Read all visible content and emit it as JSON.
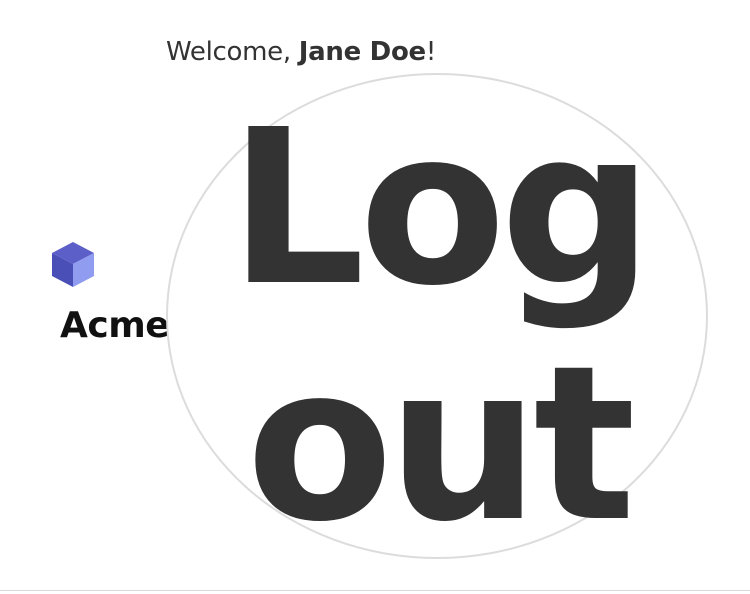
{
  "header": {
    "welcome_prefix": "Welcome, ",
    "user_name": "Jane Doe",
    "welcome_suffix": "!"
  },
  "brand": {
    "name": "Acme",
    "logo_icon": "cube-icon",
    "colors": {
      "top": "#5b5fc7",
      "left": "#4a4fb8",
      "right": "#8f9cf0"
    }
  },
  "logout": {
    "label": "Log out"
  }
}
